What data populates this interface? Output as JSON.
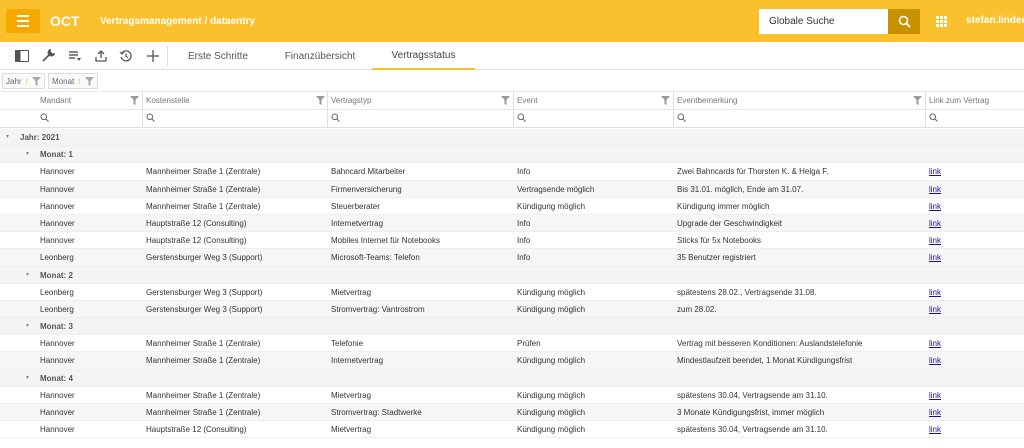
{
  "header": {
    "app_title": "OCT",
    "breadcrumb": "Vertragsmanagement / dataentry",
    "search_placeholder": "Globale Suche",
    "username": "stefan.lindenla"
  },
  "tabs": [
    {
      "label": "Erste Schritte",
      "active": false
    },
    {
      "label": "Finanzübersicht",
      "active": false
    },
    {
      "label": "Vertragsstatus",
      "active": true
    }
  ],
  "group_chips": [
    "Jahr",
    "Monat"
  ],
  "columns": [
    "Mandant",
    "Kostenstelle",
    "Vertragstyp",
    "Event",
    "Eventbemerkung",
    "Link zum Vertrag"
  ],
  "rows": [
    {
      "type": "group",
      "level": 0,
      "label": "Jahr: 2021"
    },
    {
      "type": "group",
      "level": 1,
      "label": "Monat: 1"
    },
    {
      "type": "data",
      "cells": [
        "Hannover",
        "Mannheimer Straße 1 (Zentrale)",
        "Bahncard Mitarbeiter",
        "Info",
        "Zwei Bahncards für Thorsten K. & Helga F.",
        "link"
      ]
    },
    {
      "type": "data",
      "cells": [
        "Hannover",
        "Mannheimer Straße 1 (Zentrale)",
        "Firmenversicherung",
        "Vertragsende möglich",
        "Bis 31.01. möglich, Ende am 31.07.",
        "link"
      ]
    },
    {
      "type": "data",
      "cells": [
        "Hannover",
        "Mannheimer Straße 1 (Zentrale)",
        "Steuerberater",
        "Kündigung möglich",
        "Kündigung immer möglich",
        "link"
      ]
    },
    {
      "type": "data",
      "cells": [
        "Hannover",
        "Hauptstraße 12 (Consulting)",
        "Internetvertrag",
        "Info",
        "Upgrade der Geschwindigkeit",
        "link"
      ]
    },
    {
      "type": "data",
      "cells": [
        "Hannover",
        "Hauptstraße 12 (Consulting)",
        "Mobiles Internet für Notebooks",
        "Info",
        "Sticks für 5x Notebooks",
        "link"
      ]
    },
    {
      "type": "data",
      "cells": [
        "Leonberg",
        "Gerstensburger Weg 3 (Support)",
        "Microsoft-Teams: Telefon",
        "Info",
        "35 Benutzer registriert",
        "link"
      ]
    },
    {
      "type": "group",
      "level": 1,
      "label": "Monat: 2"
    },
    {
      "type": "data",
      "cells": [
        "Leonberg",
        "Gerstensburger Weg 3 (Support)",
        "Mietvertrag",
        "Kündigung möglich",
        "spätestens 28.02., Vertragsende 31.08.",
        "link"
      ]
    },
    {
      "type": "data",
      "cells": [
        "Leonberg",
        "Gerstensburger Weg 3 (Support)",
        "Stromvertrag: Vantrostrom",
        "Kündigung möglich",
        "zum 28.02.",
        "link"
      ]
    },
    {
      "type": "group",
      "level": 1,
      "label": "Monat: 3"
    },
    {
      "type": "data",
      "cells": [
        "Hannover",
        "Mannheimer Straße 1 (Zentrale)",
        "Telefonie",
        "Prüfen",
        "Vertrag mit besseren Konditionen: Auslandstelefonie",
        "link"
      ]
    },
    {
      "type": "data",
      "cells": [
        "Hannover",
        "Mannheimer Straße 1 (Zentrale)",
        "Internetvertrag",
        "Kündigung möglich",
        "Mindestlaufzeit beendet, 1 Monat Kündigungsfrist",
        "link"
      ]
    },
    {
      "type": "group",
      "level": 1,
      "label": "Monat: 4"
    },
    {
      "type": "data",
      "cells": [
        "Hannover",
        "Mannheimer Straße 1 (Zentrale)",
        "Mietvertrag",
        "Kündigung möglich",
        "spätestens 30.04, Vertragsende am 31.10.",
        "link"
      ]
    },
    {
      "type": "data",
      "cells": [
        "Hannover",
        "Mannheimer Straße 1 (Zentrale)",
        "Stromvertrag: Stadtwerke",
        "Kündigung möglich",
        "3 Monate Kündigungsfrist, immer möglich",
        "link"
      ]
    },
    {
      "type": "data",
      "cells": [
        "Hannover",
        "Hauptstraße 12 (Consulting)",
        "Mietvertrag",
        "Kündigung möglich",
        "spätestens 30.04, Vertragsende am 31.10.",
        "link"
      ]
    }
  ],
  "colors": {
    "accent": "#fbc02d",
    "accent_dark": "#c79100",
    "link": "#1a0dab"
  }
}
